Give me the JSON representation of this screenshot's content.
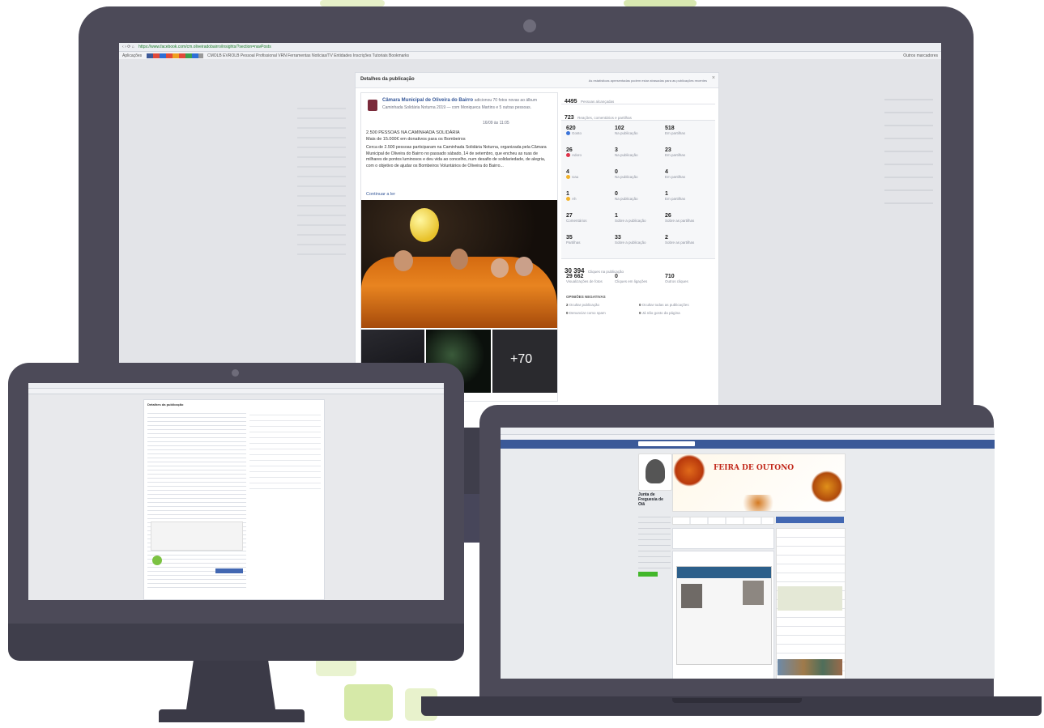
{
  "colors": {
    "bezel": "#4c4a58",
    "bezel_dark": "#3e3d4a",
    "facebook_blue": "#3b5998",
    "link": "#365899",
    "accent_green": "#c8e08a",
    "page_bg": "#ffffff"
  },
  "large_monitor": {
    "browser": {
      "url": "https://www.facebook.com/cm.oliveiradobairro/insights/?section=navPosts",
      "bookmarks": [
        "Aplicações",
        "CMOLB",
        "EVROLB",
        "Pessoal",
        "Profissional",
        "VRN",
        "Ferramentas",
        "Notícias/TV",
        "Entidades",
        "Inscrições",
        "Tutoriais",
        "Bookmarks",
        "Outros marcadores"
      ]
    },
    "dialog": {
      "title": "Detalhes da publicação",
      "header_note": "As estatísticas apresentadas podem estar atrasadas para as publicações recentes",
      "post": {
        "author": "Câmara Municipal de Oliveira do Bairro",
        "meta": "adicionou 70 fotos novas ao álbum Caminhada Solidária Noturna 2019 — com Moniqueca Martins e 5 outras pessoas.",
        "date": "16/09 às 11:05",
        "headline": "2.500 PESSOAS NA CAMINHADA SOLIDÁRIA",
        "subheadline": "Mais de 15.000€ em donativos para os Bombeiros",
        "body": "Cerca de 2.500 pessoas participaram na Caminhada Solidária Noturna, organizada pela Câmara Municipal de Oliveira do Bairro no passado sábado, 14 de setembro, que encheu as ruas de milhares de pontos luminosos e deu vida ao concelho, num desafio de solidariedade, de alegria, com o objetivo de ajudar os Bombeiros Voluntários de Oliveira do Bairro...",
        "continue": "Continuar a ler",
        "more_photos": "+70"
      },
      "stats": {
        "reached_value": "4495",
        "reached_label": "Pessoas alcançadas",
        "reactions_value": "723",
        "reactions_label": "Reações, comentários e partilhas",
        "grid": [
          {
            "value": "620",
            "label": "Gosto"
          },
          {
            "value": "102",
            "label": "Na publicação"
          },
          {
            "value": "518",
            "label": "Em partilhas"
          },
          {
            "value": "26",
            "label": "Adoro"
          },
          {
            "value": "3",
            "label": "Na publicação"
          },
          {
            "value": "23",
            "label": "Em partilhas"
          },
          {
            "value": "4",
            "label": "Uau"
          },
          {
            "value": "0",
            "label": "Na publicação"
          },
          {
            "value": "4",
            "label": "Em partilhas"
          },
          {
            "value": "1",
            "label": "Ah"
          },
          {
            "value": "0",
            "label": "Na publicação"
          },
          {
            "value": "1",
            "label": "Em partilhas"
          },
          {
            "value": "27",
            "label": "Comentários"
          },
          {
            "value": "1",
            "label": "Sobre a publicação"
          },
          {
            "value": "26",
            "label": "Sobre as partilhas"
          },
          {
            "value": "35",
            "label": "Partilhas"
          },
          {
            "value": "33",
            "label": "Sobre a publicação"
          },
          {
            "value": "2",
            "label": "Sobre as partilhas"
          }
        ],
        "clicks_value": "30 394",
        "clicks_label": "Cliques na publicação",
        "clicks_grid": [
          {
            "value": "29 662",
            "label": "Visualizações de fotos"
          },
          {
            "value": "0",
            "label": "Cliques em ligações"
          },
          {
            "value": "710",
            "label": "Outros cliques"
          }
        ],
        "negative_title": "OPINIÕES NEGATIVAS",
        "negative": [
          {
            "value": "2",
            "label": "Ocultar publicação"
          },
          {
            "value": "0",
            "label": "Ocultar todas as publicações"
          },
          {
            "value": "0",
            "label": "Denunciar como spam"
          },
          {
            "value": "0",
            "label": "Já não gosto da página"
          }
        ]
      }
    }
  },
  "small_monitor": {
    "dialog_title": "Detalhes da publicação"
  },
  "laptop": {
    "page_name": "Junta de Freguesia de Oiã",
    "banner_title": "FEIRA DE OUTONO"
  }
}
